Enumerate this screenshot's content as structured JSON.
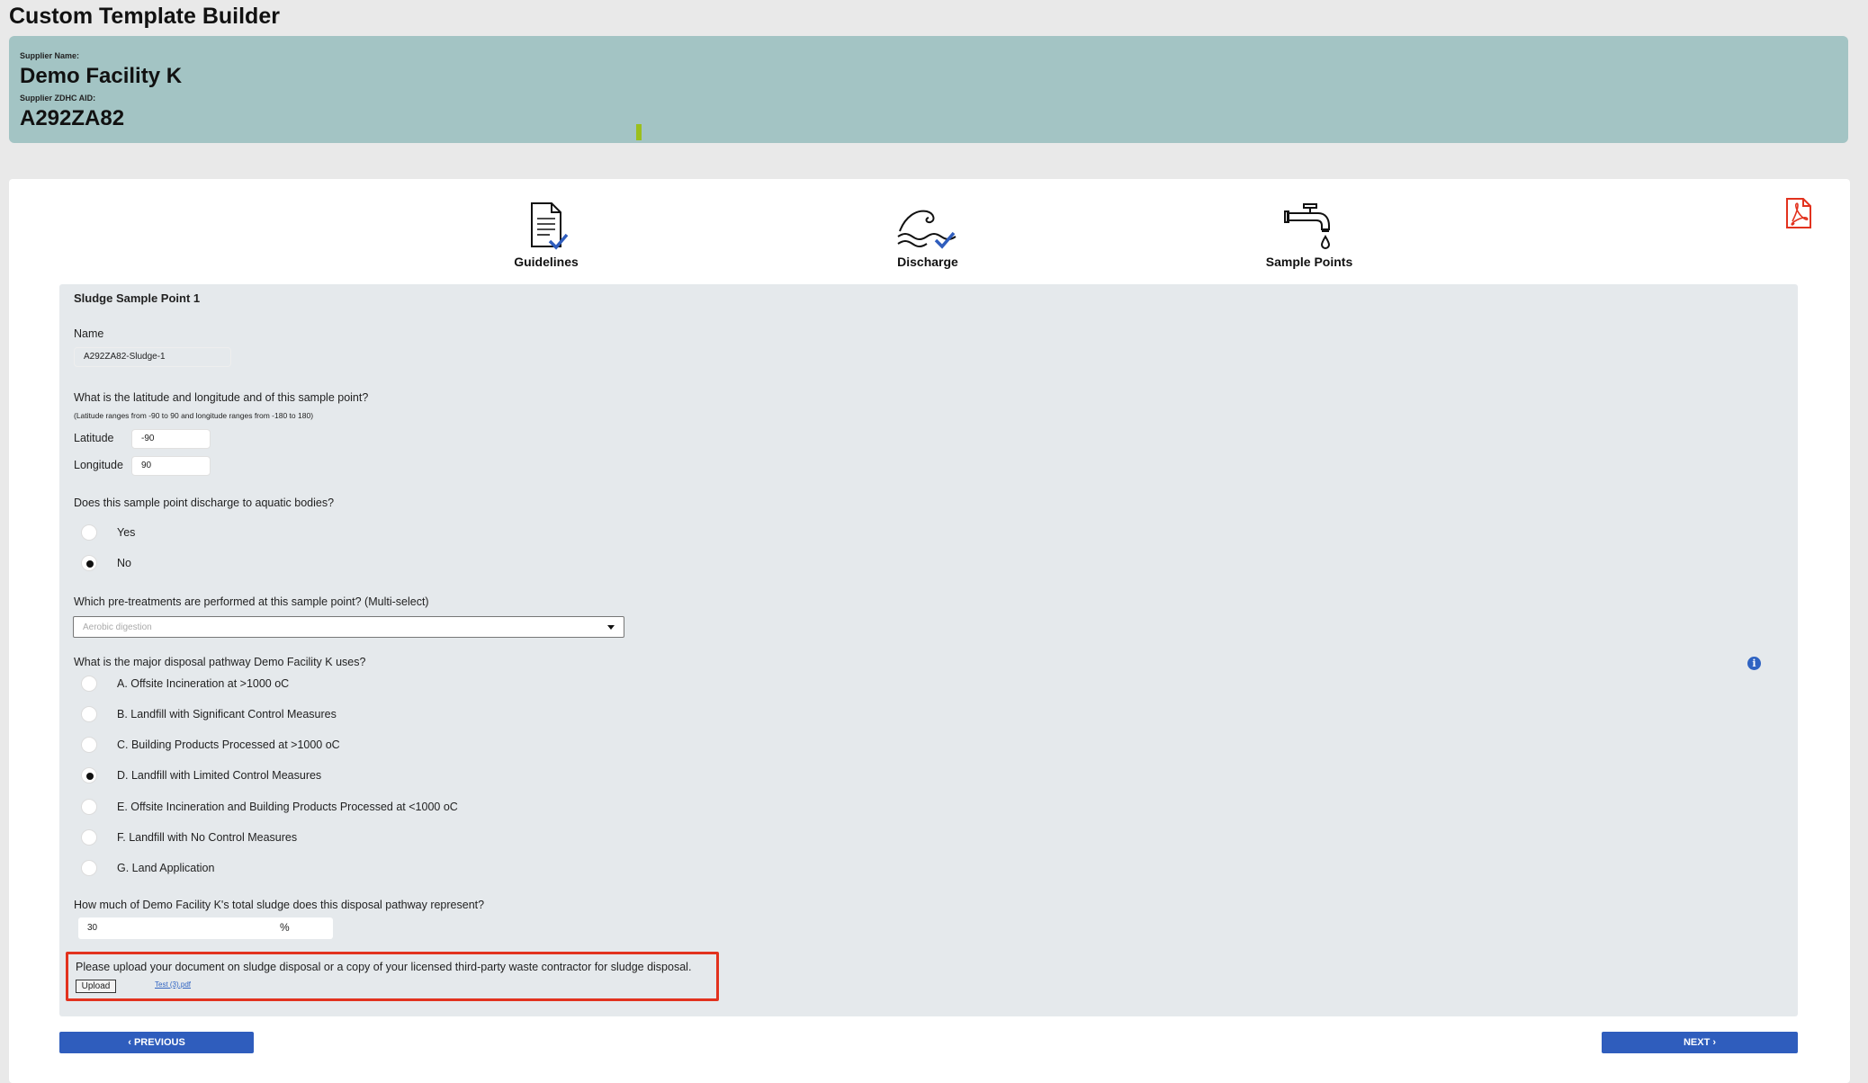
{
  "app": {
    "title": "Custom Template Builder"
  },
  "supplier": {
    "name_label": "Supplier Name:",
    "name": "Demo Facility K",
    "aid_label": "Supplier ZDHC AID:",
    "aid": "A292ZA82"
  },
  "steps": [
    {
      "label": "Guidelines",
      "icon": "document-check-icon"
    },
    {
      "label": "Discharge",
      "icon": "wave-check-icon"
    },
    {
      "label": "Sample Points",
      "icon": "faucet-icon"
    }
  ],
  "form": {
    "section_title": "Sludge Sample Point 1",
    "name_label": "Name",
    "name_value": "A292ZA82-Sludge-1",
    "latlon_question": "What is the latitude and longitude and of this sample point?",
    "latlon_hint": "(Latitude ranges from -90 to 90 and longitude ranges from -180 to 180)",
    "latitude_label": "Latitude",
    "latitude_value": "-90",
    "longitude_label": "Longitude",
    "longitude_value": "90",
    "aquatic_question": "Does this sample point discharge to aquatic bodies?",
    "aquatic_options": [
      {
        "label": "Yes",
        "checked": false
      },
      {
        "label": "No",
        "checked": true
      }
    ],
    "pretreat_question": "Which pre-treatments are performed at this sample point? (Multi-select)",
    "pretreat_selected": "Aerobic digestion",
    "disposal_question": "What is the major disposal pathway Demo Facility K uses?",
    "disposal_options": [
      {
        "label": "A. Offsite Incineration at >1000 oC",
        "checked": false
      },
      {
        "label": "B. Landfill with Significant Control Measures",
        "checked": false
      },
      {
        "label": "C. Building Products Processed at >1000 oC",
        "checked": false
      },
      {
        "label": "D. Landfill with Limited Control Measures",
        "checked": true
      },
      {
        "label": "E. Offsite Incineration and Building Products Processed at <1000 oC",
        "checked": false
      },
      {
        "label": "F. Landfill with No Control Measures",
        "checked": false
      },
      {
        "label": "G. Land Application",
        "checked": false
      }
    ],
    "sludge_question": "How much of Demo Facility K's total sludge does this disposal pathway represent?",
    "sludge_value": "30",
    "sludge_unit": "%",
    "upload_text": "Please upload your document on sludge disposal or a copy of your licensed third-party waste contractor for sludge disposal.",
    "upload_button": "Upload",
    "uploaded_file": "Test (3).pdf"
  },
  "nav": {
    "previous_label": "PREVIOUS",
    "next_label": "NEXT"
  },
  "colors": {
    "banner": "#a3c4c4",
    "primary_button": "#2f5dbd",
    "highlight_border": "#e2321e",
    "pdf_icon": "#e2321e",
    "info_icon": "#2f63c2"
  }
}
